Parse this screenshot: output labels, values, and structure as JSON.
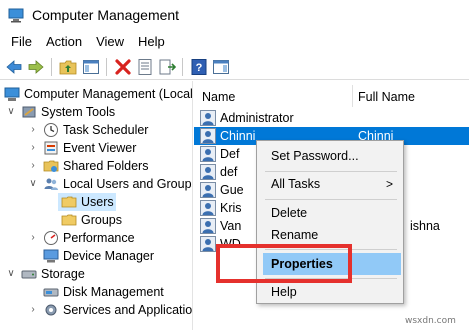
{
  "window": {
    "title": "Computer Management"
  },
  "menubar": {
    "items": [
      "File",
      "Action",
      "View",
      "Help"
    ]
  },
  "tree": {
    "root": "Computer Management (Local",
    "system_tools": "System Tools",
    "task_scheduler": "Task Scheduler",
    "event_viewer": "Event Viewer",
    "shared_folders": "Shared Folders",
    "local_users_groups": "Local Users and Groups",
    "users": "Users",
    "groups": "Groups",
    "performance": "Performance",
    "device_manager": "Device Manager",
    "storage": "Storage",
    "disk_management": "Disk Management",
    "services_apps": "Services and Applications"
  },
  "list": {
    "columns": {
      "name": "Name",
      "full_name": "Full Name"
    },
    "rows": [
      {
        "name": "Administrator",
        "full_name": ""
      },
      {
        "name": "Chinni",
        "full_name": "Chinni"
      },
      {
        "name": "Def",
        "full_name": ""
      },
      {
        "name": "def",
        "full_name": ""
      },
      {
        "name": "Gue",
        "full_name": ""
      },
      {
        "name": "Kris",
        "full_name": ""
      },
      {
        "name": "Van",
        "full_name": "ishna"
      },
      {
        "name": "WD",
        "full_name": ""
      }
    ]
  },
  "context_menu": {
    "set_password": "Set Password...",
    "all_tasks": "All Tasks",
    "all_tasks_arrow": ">",
    "delete": "Delete",
    "rename": "Rename",
    "properties": "Properties",
    "help": "Help"
  },
  "watermark": "wsxdn.com",
  "colors": {
    "selection": "#0078d7",
    "menu_highlight": "#91c9f7",
    "annotation": "#e5312d"
  }
}
